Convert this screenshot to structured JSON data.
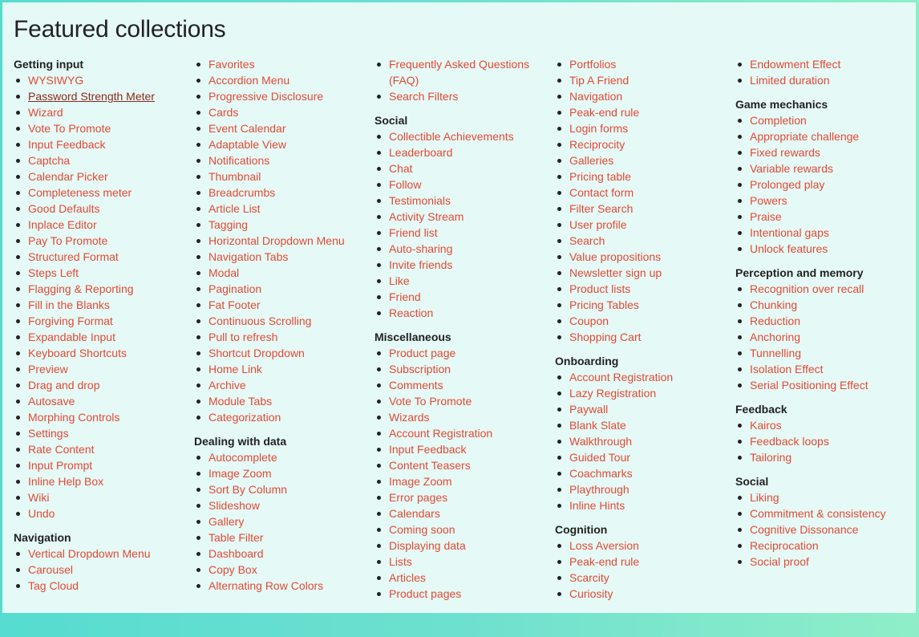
{
  "page_title": "Featured collections",
  "colors": {
    "link": "#e24a35",
    "visited_link": "#8a2a1c",
    "panel_bg": "#e5f9f6"
  },
  "columns": [
    {
      "groups": [
        {
          "title": "Getting input",
          "items": [
            "WYSIWYG",
            "Password Strength Meter",
            "Wizard",
            "Vote To Promote",
            "Input Feedback",
            "Captcha",
            "Calendar Picker",
            "Completeness meter",
            "Good Defaults",
            "Inplace Editor",
            "Pay To Promote",
            "Structured Format",
            "Steps Left",
            "Flagging & Reporting",
            "Fill in the Blanks",
            "Forgiving Format",
            "Expandable Input",
            "Keyboard Shortcuts",
            "Preview",
            "Drag and drop",
            "Autosave",
            "Morphing Controls",
            "Settings",
            "Rate Content",
            "Input Prompt",
            "Inline Help Box",
            "Wiki",
            "Undo"
          ]
        },
        {
          "title": "Navigation",
          "items": [
            "Vertical Dropdown Menu",
            "Carousel",
            "Tag Cloud"
          ]
        }
      ]
    },
    {
      "groups": [
        {
          "title": "",
          "items": [
            "Favorites",
            "Accordion Menu",
            "Progressive Disclosure",
            "Cards",
            "Event Calendar",
            "Adaptable View",
            "Notifications",
            "Thumbnail",
            "Breadcrumbs",
            "Article List",
            "Tagging",
            "Horizontal Dropdown Menu",
            "Navigation Tabs",
            "Modal",
            "Pagination",
            "Fat Footer",
            "Continuous Scrolling",
            "Pull to refresh",
            "Shortcut Dropdown",
            "Home Link",
            "Archive",
            "Module Tabs",
            "Categorization"
          ]
        },
        {
          "title": "Dealing with data",
          "items": [
            "Autocomplete",
            "Image Zoom",
            "Sort By Column",
            "Slideshow",
            "Gallery",
            "Table Filter",
            "Dashboard",
            "Copy Box",
            "Alternating Row Colors"
          ]
        }
      ]
    },
    {
      "groups": [
        {
          "title": "",
          "items": [
            "Frequently Asked Questions (FAQ)",
            "Search Filters"
          ]
        },
        {
          "title": "Social",
          "items": [
            "Collectible Achievements",
            "Leaderboard",
            "Chat",
            "Follow",
            "Testimonials",
            "Activity Stream",
            "Friend list",
            "Auto-sharing",
            "Invite friends",
            "Like",
            "Friend",
            "Reaction"
          ]
        },
        {
          "title": "Miscellaneous",
          "items": [
            "Product page",
            "Subscription",
            "Comments",
            "Vote To Promote",
            "Wizards",
            "Account Registration",
            "Input Feedback",
            "Content Teasers",
            "Image Zoom",
            "Error pages",
            "Calendars",
            "Coming soon",
            "Displaying data",
            "Lists",
            "Articles",
            "Product pages"
          ]
        }
      ]
    },
    {
      "groups": [
        {
          "title": "",
          "items": [
            "Portfolios",
            "Tip A Friend",
            "Navigation",
            "Peak-end rule",
            "Login forms",
            "Reciprocity",
            "Galleries",
            "Pricing table",
            "Contact form",
            "Filter Search",
            "User profile",
            "Search",
            "Value propositions",
            "Newsletter sign up",
            "Product lists",
            "Pricing Tables",
            "Coupon",
            "Shopping Cart"
          ]
        },
        {
          "title": "Onboarding",
          "items": [
            "Account Registration",
            "Lazy Registration",
            "Paywall",
            "Blank Slate",
            "Walkthrough",
            "Guided Tour",
            "Coachmarks",
            "Playthrough",
            "Inline Hints"
          ]
        },
        {
          "title": "Cognition",
          "items": [
            "Loss Aversion",
            "Peak-end rule",
            "Scarcity",
            "Curiosity"
          ]
        }
      ]
    },
    {
      "groups": [
        {
          "title": "",
          "items": [
            "Endowment Effect",
            "Limited duration"
          ]
        },
        {
          "title": "Game mechanics",
          "items": [
            "Completion",
            "Appropriate challenge",
            "Fixed rewards",
            "Variable rewards",
            "Prolonged play",
            "Powers",
            "Praise",
            "Intentional gaps",
            "Unlock features"
          ]
        },
        {
          "title": "Perception and memory",
          "items": [
            "Recognition over recall",
            "Chunking",
            "Reduction",
            "Anchoring",
            "Tunnelling",
            "Isolation Effect",
            "Serial Positioning Effect"
          ]
        },
        {
          "title": "Feedback",
          "items": [
            "Kairos",
            "Feedback loops",
            "Tailoring"
          ]
        },
        {
          "title": "Social",
          "items": [
            "Liking",
            "Commitment & consistency",
            "Cognitive Dissonance",
            "Reciprocation",
            "Social proof"
          ]
        }
      ]
    }
  ]
}
